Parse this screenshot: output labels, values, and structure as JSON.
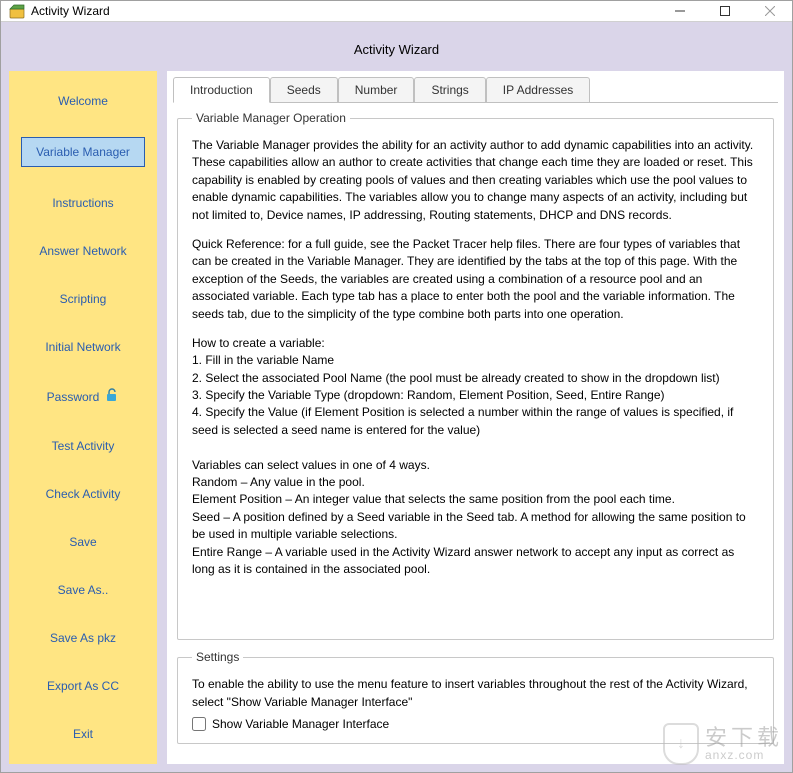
{
  "window": {
    "title": "Activity Wizard"
  },
  "header": {
    "title": "Activity Wizard"
  },
  "sidebar": {
    "items": [
      {
        "label": "Welcome",
        "selected": false
      },
      {
        "label": "Variable Manager",
        "selected": true
      },
      {
        "label": "Instructions",
        "selected": false
      },
      {
        "label": "Answer Network",
        "selected": false
      },
      {
        "label": "Scripting",
        "selected": false
      },
      {
        "label": "Initial Network",
        "selected": false
      },
      {
        "label": "Password",
        "selected": false,
        "icon": "unlock-icon"
      },
      {
        "label": "Test Activity",
        "selected": false
      },
      {
        "label": "Check Activity",
        "selected": false
      },
      {
        "label": "Save",
        "selected": false
      },
      {
        "label": "Save As..",
        "selected": false
      },
      {
        "label": "Save As pkz",
        "selected": false
      },
      {
        "label": "Export As CC",
        "selected": false
      },
      {
        "label": "Exit",
        "selected": false
      }
    ]
  },
  "tabs": {
    "items": [
      {
        "label": "Introduction",
        "active": true
      },
      {
        "label": "Seeds",
        "active": false
      },
      {
        "label": "Number",
        "active": false
      },
      {
        "label": "Strings",
        "active": false
      },
      {
        "label": "IP Addresses",
        "active": false
      }
    ]
  },
  "operation": {
    "legend": "Variable Manager Operation",
    "para1": "The Variable Manager provides the ability for an activity author to add dynamic capabilities into an activity. These capabilities allow an author to create activities that change each time they are loaded or reset. This capability is enabled by creating pools of values and then creating variables which use the pool values to enable dynamic capabilities. The variables allow you to change many aspects of an activity, including but not limited to, Device names, IP addressing, Routing statements, DHCP and DNS records.",
    "para2": "Quick Reference: for a full guide, see the Packet Tracer help files. There are four types of variables that can be created in the Variable Manager. They are identified by the tabs at the top of this page. With the exception of the Seeds, the variables are created using a combination of a resource pool and an associated variable. Each type tab has a place to enter both the pool and the variable information. The seeds tab, due to the simplicity of the type combine both parts into one operation.",
    "howto_title": "How to create a variable:",
    "howto1": "1. Fill in the variable Name",
    "howto2": "2. Select the associated Pool Name (the pool must be already created to show in the dropdown list)",
    "howto3": "3. Specify the Variable Type (dropdown: Random, Element Position, Seed, Entire Range)",
    "howto4": "4. Specify the Value (if Element Position is selected a number within the range of values is specified, if seed is selected a seed name is entered for the value)",
    "ways_title": "Variables can select values in one of 4 ways.",
    "ways_random": "Random – Any value in the pool.",
    "ways_element": "Element Position – An integer value that selects the same position from the pool each time.",
    "ways_seed": "Seed – A position defined by a Seed variable in the Seed tab. A method for allowing the same position to be used in multiple variable selections.",
    "ways_range": "Entire Range – A variable used in the Activity Wizard answer network to accept any input as correct as long as it is contained in the associated pool."
  },
  "settings": {
    "legend": "Settings",
    "desc": "To enable the ability to use the menu feature to insert variables throughout the rest of the Activity Wizard, select \"Show Variable Manager Interface\"",
    "checkbox_label": "Show Variable Manager Interface",
    "checked": false
  },
  "watermark": {
    "cn": "安下载",
    "url": "anxz.com"
  }
}
